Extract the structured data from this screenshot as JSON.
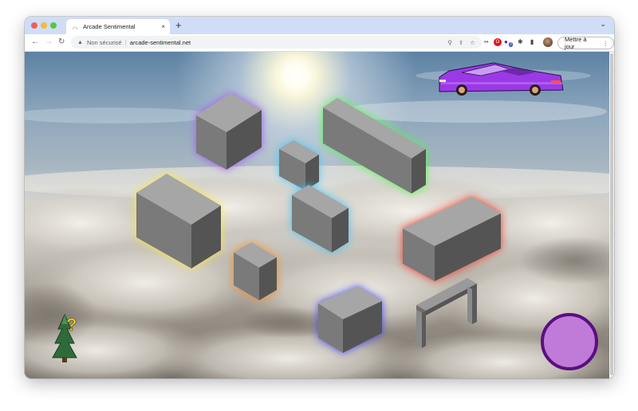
{
  "browser": {
    "tab": {
      "title": "Arcade Sentimental",
      "close_glyph": "×",
      "favicon": "feather-icon"
    },
    "new_tab_glyph": "+",
    "tabs_menu_glyph": "⌄",
    "address_bar": {
      "security_text": "Non sécurisé",
      "separator": "|",
      "url": "arcade-sentimental.net"
    },
    "update_button_label": "Mettre à jour",
    "menu_glyph": "⋮",
    "extension_badge_count": "3"
  },
  "scene": {
    "background": "sky-above-clouds-with-sun",
    "glow_colors": {
      "purple": "#a44cff",
      "green": "#45ff3e",
      "cyan": "#37c6ff",
      "yellow": "#ffee33",
      "red": "#ff2a1a",
      "orange": "#ff8c1a",
      "blue": "#3a3cff"
    },
    "car": {
      "name": "purple-delorean",
      "color": "#9b39e6"
    },
    "tree_question_mark": "?",
    "action_button_color": "#c07ad8"
  }
}
